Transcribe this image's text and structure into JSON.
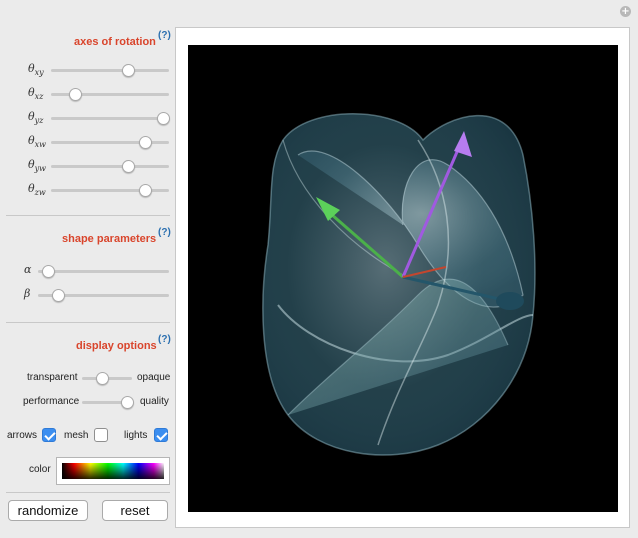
{
  "sections": {
    "axes_title": "axes of rotation",
    "shape_title": "shape parameters",
    "display_title": "display options",
    "help": "(?)"
  },
  "rotation_sliders": [
    {
      "symbol": "θ",
      "sub": "xy",
      "value": 0.65
    },
    {
      "symbol": "θ",
      "sub": "xz",
      "value": 0.2
    },
    {
      "symbol": "θ",
      "sub": "yz",
      "value": 1.0
    },
    {
      "symbol": "θ",
      "sub": "xw",
      "value": 0.8
    },
    {
      "symbol": "θ",
      "sub": "yw",
      "value": 0.65
    },
    {
      "symbol": "θ",
      "sub": "zw",
      "value": 0.8
    }
  ],
  "shape_sliders": [
    {
      "symbol": "α",
      "value": 0.08
    },
    {
      "symbol": "β",
      "value": 0.15
    }
  ],
  "display": {
    "transparent_label": "transparent",
    "opaque_label": "opaque",
    "transparency_value": 0.4,
    "performance_label": "performance",
    "quality_label": "quality",
    "quality_value": 0.9,
    "arrows_label": "arrows",
    "arrows_checked": true,
    "mesh_label": "mesh",
    "mesh_checked": false,
    "lights_label": "lights",
    "lights_checked": true,
    "color_label": "color"
  },
  "buttons": {
    "randomize": "randomize",
    "reset": "reset"
  },
  "icons": {
    "expand": "plus-icon"
  },
  "colors": {
    "section_title": "#d9452c",
    "help_link": "#2a6fb0",
    "checkbox_on": "#3b8ef0"
  }
}
